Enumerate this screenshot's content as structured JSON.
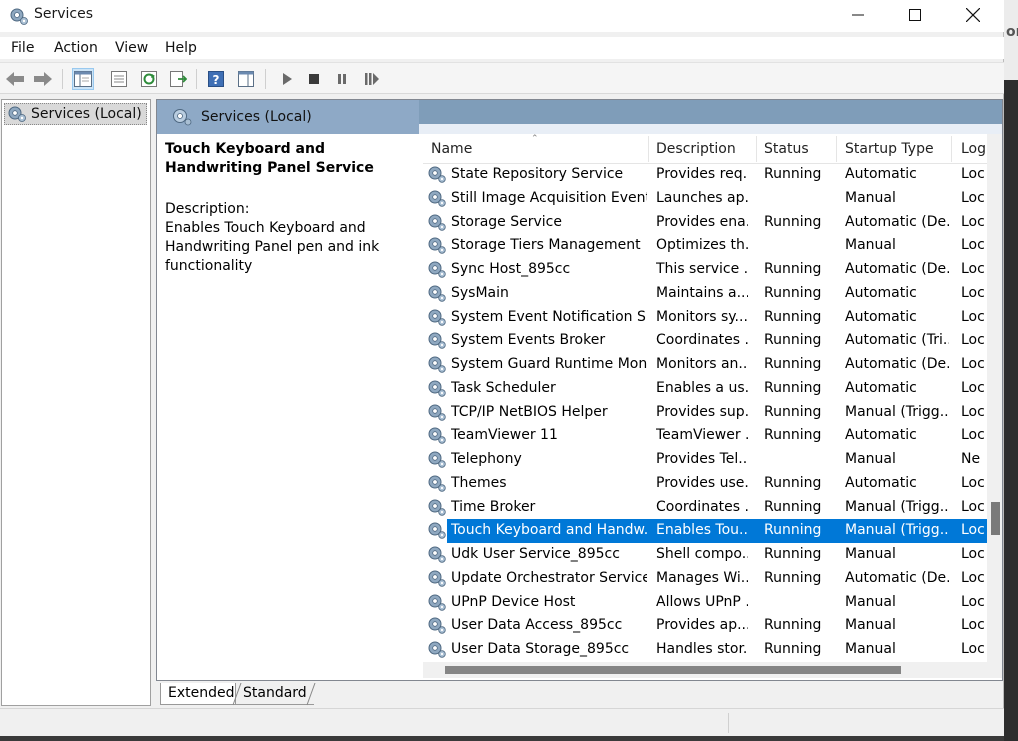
{
  "window": {
    "title": "Services",
    "minimize_icon": "minimize-icon",
    "maximize_icon": "maximize-icon",
    "close_icon": "close-icon"
  },
  "menu": [
    "File",
    "Action",
    "View",
    "Help"
  ],
  "toolbar": {
    "icons": [
      "back-arrow-icon",
      "forward-arrow-icon",
      "show-hide-console-tree-icon",
      "properties-icon",
      "refresh-icon",
      "export-list-icon",
      "help-icon",
      "action-pane-icon",
      "start-service-icon",
      "stop-service-icon",
      "pause-service-icon",
      "restart-service-icon"
    ]
  },
  "tree": {
    "root_label": "Services (Local)"
  },
  "pane": {
    "header_title": "Services (Local)",
    "selected_title": "Touch Keyboard and Handwriting Panel Service",
    "description_label": "Description:",
    "description_text": "Enables Touch Keyboard and Handwriting Panel pen and ink functionality"
  },
  "columns": {
    "name": "Name",
    "description": "Description",
    "status": "Status",
    "startup": "Startup Type",
    "logon": "Log"
  },
  "services": [
    {
      "name": "State Repository Service",
      "description": "Provides req...",
      "status": "Running",
      "startup": "Automatic",
      "logon": "Loc"
    },
    {
      "name": "Still Image Acquisition Events",
      "description": "Launches ap...",
      "status": "",
      "startup": "Manual",
      "logon": "Loc"
    },
    {
      "name": "Storage Service",
      "description": "Provides ena...",
      "status": "Running",
      "startup": "Automatic (De...",
      "logon": "Loc"
    },
    {
      "name": "Storage Tiers Management",
      "description": "Optimizes th...",
      "status": "",
      "startup": "Manual",
      "logon": "Loc"
    },
    {
      "name": "Sync Host_895cc",
      "description": "This service ...",
      "status": "Running",
      "startup": "Automatic (De...",
      "logon": "Loc"
    },
    {
      "name": "SysMain",
      "description": "Maintains a...",
      "status": "Running",
      "startup": "Automatic",
      "logon": "Loc"
    },
    {
      "name": "System Event Notification S...",
      "description": "Monitors sy...",
      "status": "Running",
      "startup": "Automatic",
      "logon": "Loc"
    },
    {
      "name": "System Events Broker",
      "description": "Coordinates ...",
      "status": "Running",
      "startup": "Automatic (Tri...",
      "logon": "Loc"
    },
    {
      "name": "System Guard Runtime Mon...",
      "description": "Monitors an...",
      "status": "Running",
      "startup": "Automatic (De...",
      "logon": "Loc"
    },
    {
      "name": "Task Scheduler",
      "description": "Enables a us...",
      "status": "Running",
      "startup": "Automatic",
      "logon": "Loc"
    },
    {
      "name": "TCP/IP NetBIOS Helper",
      "description": "Provides sup...",
      "status": "Running",
      "startup": "Manual (Trigg...",
      "logon": "Loc"
    },
    {
      "name": "TeamViewer 11",
      "description": "TeamViewer ...",
      "status": "Running",
      "startup": "Automatic",
      "logon": "Loc"
    },
    {
      "name": "Telephony",
      "description": "Provides Tel...",
      "status": "",
      "startup": "Manual",
      "logon": "Ne"
    },
    {
      "name": "Themes",
      "description": "Provides use...",
      "status": "Running",
      "startup": "Automatic",
      "logon": "Loc"
    },
    {
      "name": "Time Broker",
      "description": "Coordinates ...",
      "status": "Running",
      "startup": "Manual (Trigg...",
      "logon": "Loc"
    },
    {
      "name": "Touch Keyboard and Handw...",
      "description": "Enables Tou...",
      "status": "Running",
      "startup": "Manual (Trigg...",
      "logon": "Loc",
      "selected": true
    },
    {
      "name": "Udk User Service_895cc",
      "description": "Shell compo...",
      "status": "Running",
      "startup": "Manual",
      "logon": "Loc"
    },
    {
      "name": "Update Orchestrator Service",
      "description": "Manages Wi...",
      "status": "Running",
      "startup": "Automatic (De...",
      "logon": "Loc"
    },
    {
      "name": "UPnP Device Host",
      "description": "Allows UPnP ...",
      "status": "",
      "startup": "Manual",
      "logon": "Loc"
    },
    {
      "name": "User Data Access_895cc",
      "description": "Provides ap...",
      "status": "Running",
      "startup": "Manual",
      "logon": "Loc"
    },
    {
      "name": "User Data Storage_895cc",
      "description": "Handles stor...",
      "status": "Running",
      "startup": "Manual",
      "logon": "Loc"
    }
  ],
  "tabs": [
    "Extended",
    "Standard"
  ],
  "background_fragment": "on",
  "colors": {
    "selection": "#0078d7",
    "header_band": "#7f9db9"
  }
}
